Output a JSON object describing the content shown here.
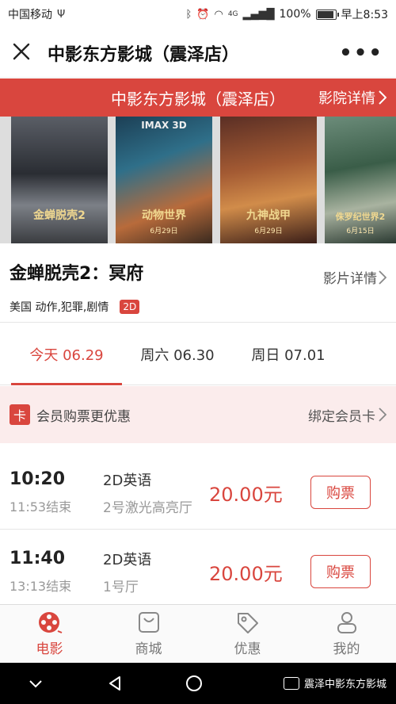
{
  "status_bar": {
    "carrier": "中国移动",
    "usb_icon": "usb-icon",
    "battery_percent": "100%",
    "network": "4G",
    "time": "早上8:53"
  },
  "title_bar": {
    "title": "中影东方影城（震泽店）",
    "close_icon": "close-icon",
    "more_icon": "more-icon"
  },
  "cinema_bar": {
    "name": "中影东方影城（震泽店）",
    "detail_link": "影院详情",
    "accent_color": "#d9463e"
  },
  "posters": [
    {
      "title": "金蝉脱壳2"
    },
    {
      "title": "动物世界",
      "top": "IMAX 3D",
      "date": "6月29日"
    },
    {
      "title": "九神战甲",
      "date": "6月29日"
    },
    {
      "title": "侏罗纪世界2",
      "date": "6月15日"
    }
  ],
  "movie": {
    "title": "金蝉脱壳2：冥府",
    "detail_link": "影片详情",
    "meta": "美国 动作,犯罪,剧情",
    "format_badge": "2D"
  },
  "date_tabs": [
    {
      "label": "今天 06.29",
      "active": true
    },
    {
      "label": "周六 06.30",
      "active": false
    },
    {
      "label": "周日 07.01",
      "active": false
    }
  ],
  "member_bar": {
    "card_icon_text": "卡",
    "text": "会员购票更优惠",
    "bind_link": "绑定会员卡"
  },
  "showtimes": [
    {
      "start": "10:20",
      "end": "11:53结束",
      "lang": "2D英语",
      "hall": "2号激光高亮厅",
      "price": "20.00元",
      "button": "购票"
    },
    {
      "start": "11:40",
      "end": "13:13结束",
      "lang": "2D英语",
      "hall": "1号厅",
      "price": "20.00元",
      "button": "购票"
    }
  ],
  "bottom_nav": [
    {
      "label": "电影",
      "icon": "film-reel-icon",
      "active": true
    },
    {
      "label": "商城",
      "icon": "shopping-bag-icon",
      "active": false
    },
    {
      "label": "优惠",
      "icon": "tag-icon",
      "active": false
    },
    {
      "label": "我的",
      "icon": "user-icon",
      "active": false
    }
  ],
  "watermark": {
    "text": "震泽中影东方影城"
  }
}
